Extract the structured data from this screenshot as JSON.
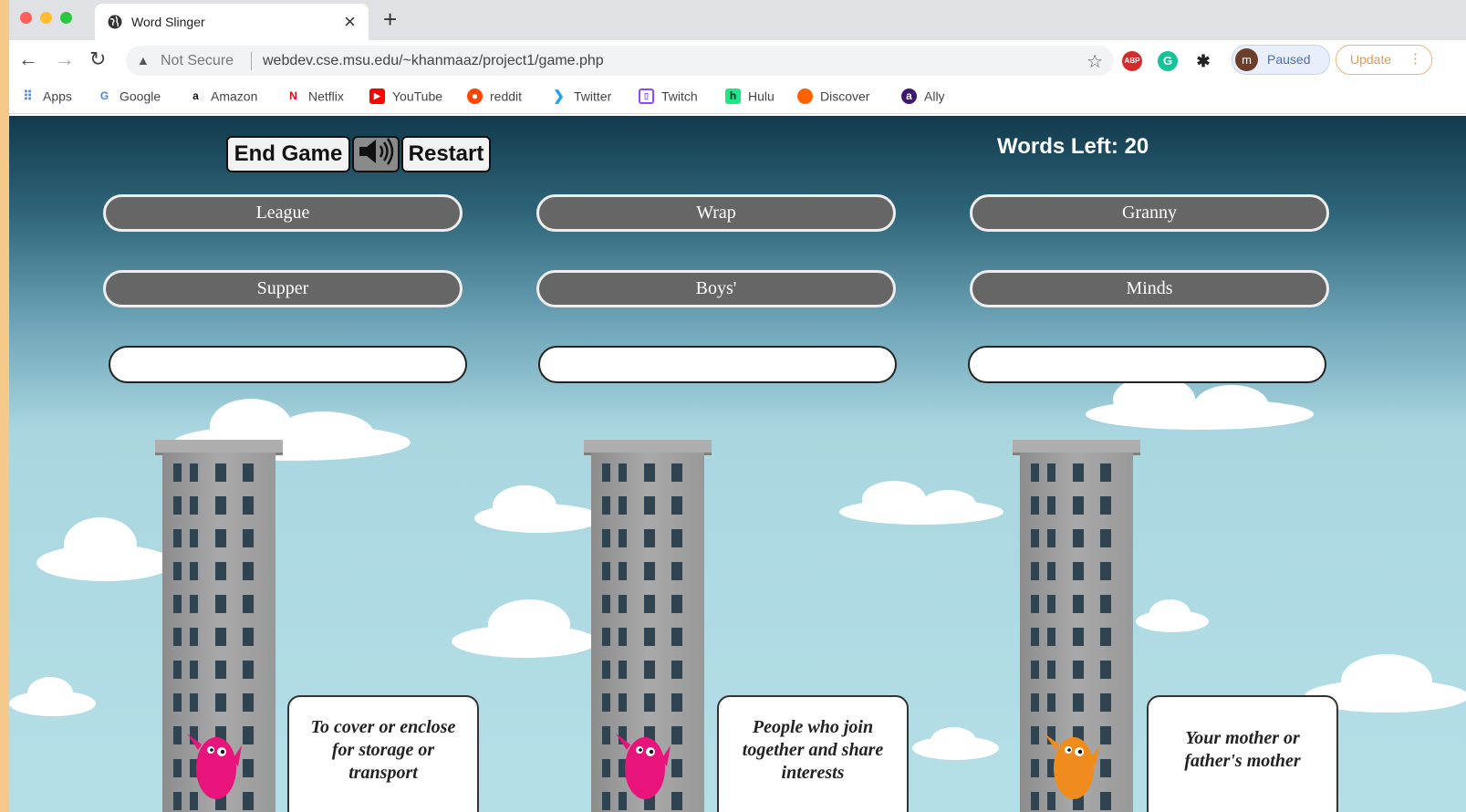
{
  "browser": {
    "tab_title": "Word Slinger",
    "tab_close": "×",
    "new_tab": "+",
    "security_label": "Not Secure",
    "url": "webdev.cse.msu.edu/~khanmaaz/project1/game.php",
    "profile_initial": "m",
    "profile_status": "Paused",
    "update_label": "Update",
    "bookmarks": [
      {
        "label": "Apps",
        "icon": "apps-grid-icon",
        "color": "#4285f4"
      },
      {
        "label": "Google",
        "icon": "google-icon",
        "color": "#4285f4"
      },
      {
        "label": "Amazon",
        "icon": "amazon-icon",
        "color": "#111111"
      },
      {
        "label": "Netflix",
        "icon": "netflix-icon",
        "color": "#e50914"
      },
      {
        "label": "YouTube",
        "icon": "youtube-icon",
        "color": "#ff0000"
      },
      {
        "label": "reddit",
        "icon": "reddit-icon",
        "color": "#ff4500"
      },
      {
        "label": "Twitter",
        "icon": "twitter-icon",
        "color": "#1da1f2"
      },
      {
        "label": "Twitch",
        "icon": "twitch-icon",
        "color": "#9146ff"
      },
      {
        "label": "Hulu",
        "icon": "hulu-icon",
        "color": "#1ce783"
      },
      {
        "label": "Discover",
        "icon": "discover-icon",
        "color": "#ff6000"
      },
      {
        "label": "Ally",
        "icon": "ally-icon",
        "color": "#3d1a6e"
      }
    ]
  },
  "game": {
    "end_game_label": "End Game",
    "restart_label": "Restart",
    "sound_icon": "speaker-icon",
    "words_left_label": "Words Left:",
    "words_left_count": "20",
    "word_choices": [
      "League",
      "Wrap",
      "Granny",
      "Supper",
      "Boys'",
      "Minds"
    ],
    "answer_slots": [
      "",
      "",
      ""
    ],
    "clues": [
      "To cover or enclose for storage or transport",
      "People who join together and share interests",
      "Your mother or father's mother"
    ],
    "character_colors": [
      "#e8137b",
      "#e8137b",
      "#f08c1d"
    ]
  }
}
